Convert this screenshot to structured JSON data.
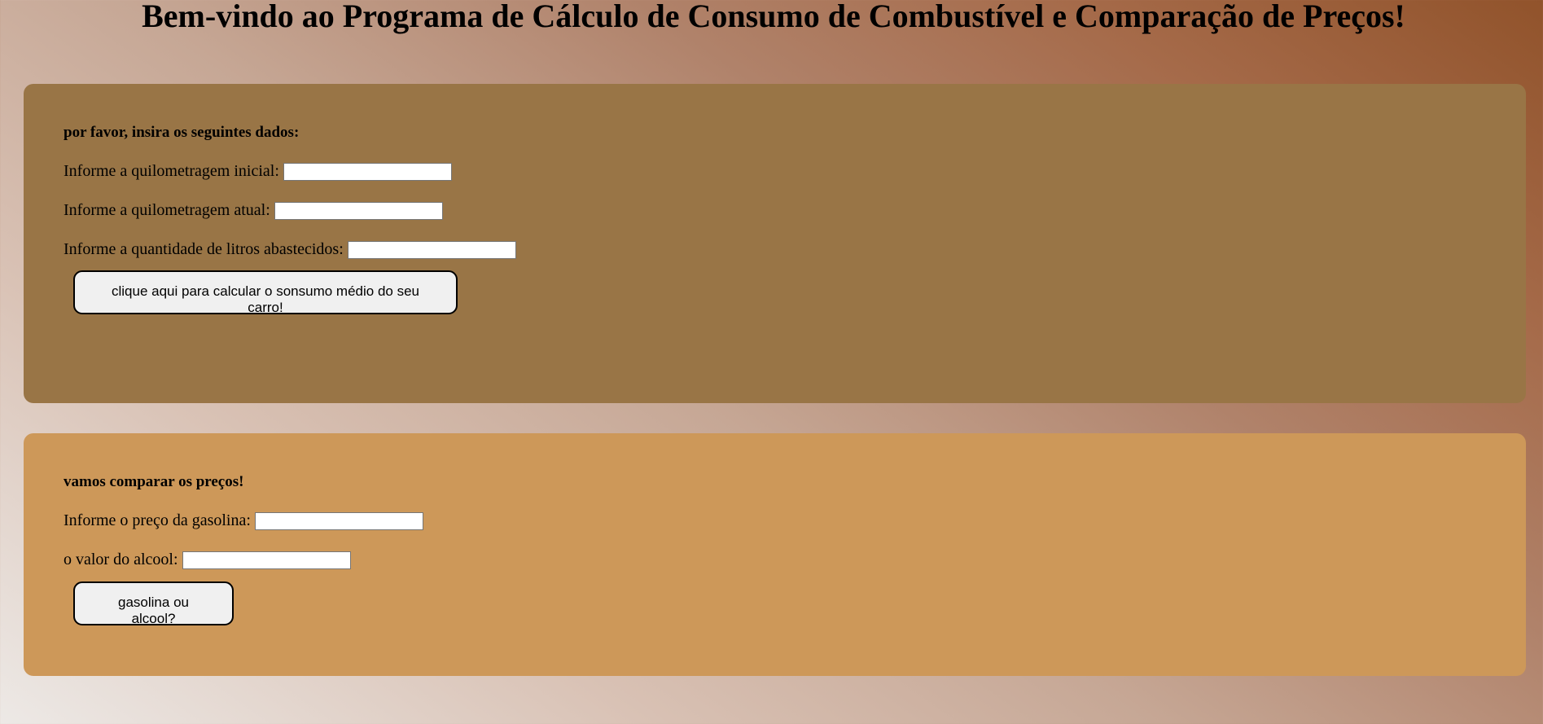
{
  "header": {
    "title": "Bem-vindo ao Programa de Cálculo de Consumo de Combustível e Comparação de Preços!"
  },
  "consumo": {
    "heading": "por favor, insira os seguintes dados:",
    "fields": [
      {
        "label": "Informe a quilometragem inicial:",
        "value": "",
        "placeholder": ""
      },
      {
        "label": "Informe a quilometragem atual:",
        "value": "",
        "placeholder": ""
      },
      {
        "label": "Informe a quantidade de litros abastecidos:",
        "value": "",
        "placeholder": ""
      }
    ],
    "button_label": "clique aqui para calcular o sonsumo médio do seu carro!"
  },
  "precos": {
    "heading": "vamos comparar os preços!",
    "fields": [
      {
        "label": "Informe o preço da gasolina:",
        "value": "",
        "placeholder": ""
      },
      {
        "label": "o valor do alcool:",
        "value": "",
        "placeholder": ""
      }
    ],
    "button_label": "gasolina ou alcool?"
  },
  "colors": {
    "panel_consumo": "#997546",
    "panel_precos": "#cd9859",
    "button_bg": "#f0f0f0"
  }
}
